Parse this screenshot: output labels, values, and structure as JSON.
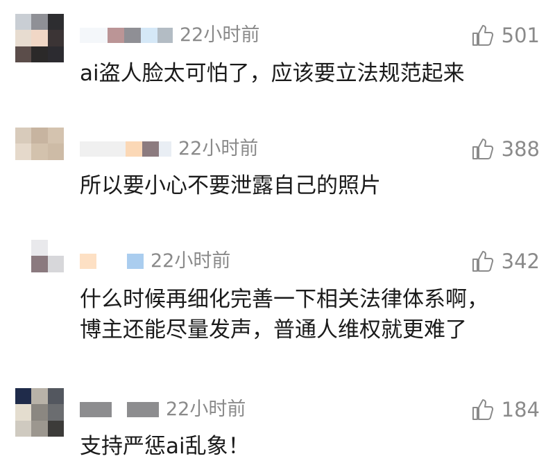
{
  "comments": [
    {
      "time": "22小时前",
      "likes": "501",
      "text": "ai盗人脸太可怕了，应该要立法规范起来",
      "avatar_colors": [
        "#c9ced4",
        "#8f9096",
        "#2d2d30",
        "#e7dcd0",
        "#f1d7c6",
        "#3b3435",
        "#5b4d4a",
        "#2b2929",
        "#2c2b30"
      ],
      "name_colors": [
        "#f4f7fa",
        "#bb9596",
        "#8f8f95",
        "#d5e8f7",
        "#b3bcc4"
      ]
    },
    {
      "time": "22小时前",
      "likes": "388",
      "text": "所以要小心不要泄露自己的照片",
      "avatar_colors": [
        "#d8cbbb",
        "#c7b4a0",
        "#d4c3af",
        "#e5d9cb",
        "#d3c2ad",
        "#cdbba6",
        "#ffffff",
        "#ffffff",
        "#ffffff"
      ],
      "name_colors": [
        "#f0f0f0",
        "#fbd8b6",
        "#8c7b7f",
        "#e9eef4"
      ]
    },
    {
      "time": "22小时前",
      "likes": "342",
      "text": "什么时候再细化完善一下相关法律体系啊，\n博主还能尽量发声，普通人维权就更难了",
      "avatar_colors": [
        "#ffffff",
        "#e9e9ec",
        "#ffffff",
        "#ffffff",
        "#8b7a7f",
        "#d7d7da",
        "#ffffff",
        "#ffffff",
        "#ffffff"
      ],
      "name_colors": [
        "#fde0c4",
        "#ffffff",
        "#aacdef"
      ]
    },
    {
      "time": "22小时前",
      "likes": "184",
      "text": "支持严惩ai乱象！",
      "avatar_colors": [
        "#1f2b4a",
        "#b8b2a8",
        "#53575f",
        "#e4ddcf",
        "#8b8781",
        "#6b6d70",
        "#cfcac0",
        "#9c978f",
        "#3c3b39"
      ],
      "name_colors": [
        "#8d8d8f",
        "#ffffff",
        "#8d8d8f"
      ]
    }
  ]
}
